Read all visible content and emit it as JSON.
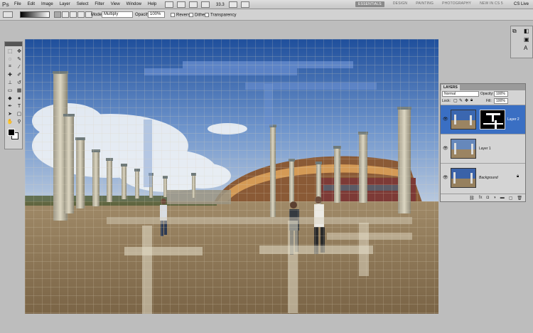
{
  "app": {
    "logo": "Ps",
    "menu": [
      "File",
      "Edit",
      "Image",
      "Layer",
      "Select",
      "Filter",
      "View",
      "Window",
      "Help"
    ],
    "zoom": "33.3",
    "workspaces": [
      "ESSENTIALS",
      "DESIGN",
      "PAINTING",
      "PHOTOGRAPHY",
      "NEW IN CS 5"
    ],
    "active_workspace": "ESSENTIALS",
    "cs_live": "CS Live"
  },
  "options": {
    "mode_label": "Mode:",
    "mode_value": "Multiply",
    "opacity_label": "Opacity:",
    "opacity_value": "100%",
    "reverse_label": "Reverse",
    "dither_label": "Dither",
    "transparency_label": "Transparency"
  },
  "layers_panel": {
    "tab": "LAYERS",
    "blend_mode": "Normal",
    "opacity_label": "Opacity:",
    "opacity_value": "100%",
    "lock_label": "Lock:",
    "fill_label": "Fill:",
    "fill_value": "100%",
    "layers": [
      {
        "name": "Layer 2",
        "active": true,
        "has_mask": true
      },
      {
        "name": "Layer 1",
        "active": false,
        "has_mask": false
      },
      {
        "name": "Background",
        "active": false,
        "has_mask": false,
        "locked": true
      }
    ]
  },
  "icons": {
    "eye": "eye-icon",
    "lock": "lock-icon",
    "link": "link-icon",
    "fx": "fx-icon",
    "trash": "trash-icon"
  },
  "colors": {
    "accent": "#3a6fc3",
    "sky": "#2f5fae",
    "ground": "#8c7a5c"
  }
}
